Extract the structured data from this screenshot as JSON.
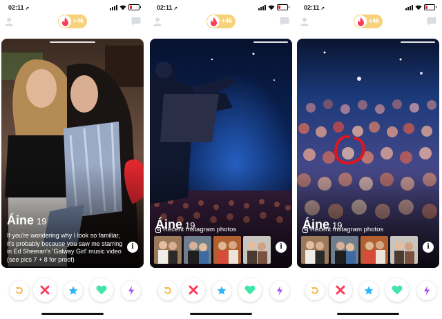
{
  "status": {
    "time": "02:11",
    "time_arrow": "➚"
  },
  "topbar": {
    "boost_count": "+46"
  },
  "profile": {
    "name": "Áine",
    "age": "19"
  },
  "screens": [
    {
      "bio": "If you're wondering why I look so familiar, it's probably because you saw me starring in Ed Sheeran's 'Galway Girl' music video (see pics 7 + 8 for proof)"
    },
    {
      "instagram_label": "Recent Instagram photos"
    },
    {
      "instagram_label": "Recent Instagram photos"
    }
  ],
  "info_label": "i",
  "colors": {
    "tinder_red": "#fd3a5a",
    "boost_gold": "#f7d27a",
    "rewind_yellow": "#f5b748",
    "superlike_blue": "#2db4f5",
    "like_green": "#3fe6a8",
    "boost_purple": "#a44bf1",
    "annotation_red": "#e4141c"
  },
  "icons": [
    "profile-icon",
    "flame-icon",
    "chat-icon",
    "rewind-icon",
    "nope-icon",
    "superlike-icon",
    "like-icon",
    "boost-icon",
    "instagram-icon",
    "info-icon"
  ]
}
